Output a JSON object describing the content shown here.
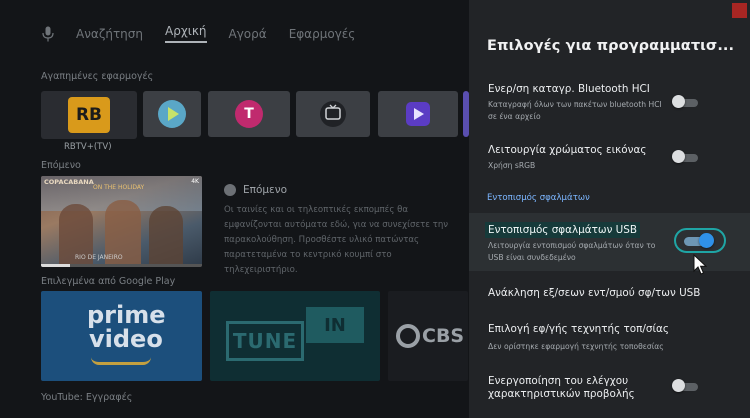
{
  "background": {
    "nav": {
      "items": [
        "Αναζήτηση",
        "Αρχική",
        "Αγορά",
        "Εφαρμογές"
      ],
      "selected": "Αρχική"
    },
    "favorites_label": "Αγαπημένες εφαρμογές",
    "favorites": [
      {
        "icon": "rbtv-icon",
        "label": "RBTV+(TV)",
        "logo_text": "RB"
      },
      {
        "icon": "play-icon"
      },
      {
        "icon": "t-icon",
        "logo_text": "T"
      },
      {
        "icon": "tv-icon"
      },
      {
        "icon": "video-icon"
      }
    ],
    "next_label": "Επόμενο",
    "next_card": {
      "caption_top": "COPACABANA",
      "caption_mid": "ON THE HOLIDAY",
      "hd_badge": "4K",
      "caption_bottom": "RIO DE JANEIRO"
    },
    "next_title": "Επόμενο",
    "next_description": "Οι ταινίες και οι τηλεοπτικές εκπομπές θα εμφανίζονται αυτόματα εδώ, για να συνεχίσετε την παρακολούθηση. Προσθέστε υλικό πατώντας παρατεταμένα το κεντρικό κουμπί στο τηλεχειριστήριο.",
    "google_play_label": "Επιλεγμένα από Google Play",
    "tiles": {
      "prime_line1": "prime",
      "prime_line2": "video",
      "tunein_left": "TUNE",
      "tunein_right": "IN",
      "cbs": "CBS N"
    },
    "youtube_label": "YouTube: Εγγραφές"
  },
  "panel": {
    "title": "Επιλογές για προγραμματισ...",
    "items": [
      {
        "title": "Ενερ/ση καταγρ. Bluetooth HCI",
        "subtitle_lines": [
          "Καταγραφή όλων των πακέτων bluetooth HCI",
          "σε ένα αρχείο"
        ],
        "toggle": false
      },
      {
        "title": "Λειτουργία χρώματος εικόνας",
        "subtitle_lines": [
          "Χρήση sRGB"
        ],
        "toggle": false
      },
      {
        "title": "Εντοπισμός σφαλμάτων USB",
        "subtitle_lines": [
          "Λειτουργία εντοπισμού σφαλμάτων όταν το",
          "USB είναι συνδεδεμένο"
        ],
        "toggle": true,
        "focused": true
      },
      {
        "title": "Ανάκληση εξ/σεων εντ/σμού σφ/των USB"
      },
      {
        "title": "Επιλογή εφ/γής τεχνητής τοπ/σίας",
        "subtitle_lines": [
          "Δεν ορίστηκε εφαρμογή τεχνητής τοποθεσίας"
        ]
      },
      {
        "title_lines": [
          "Ενεργοποίηση του ελέγχου",
          "χαρακτηριστικών προβολής"
        ],
        "toggle": false
      }
    ],
    "category_label": "Εντοπισμός σφαλμάτων"
  },
  "colors": {
    "panel_bg": "#222427",
    "focused_row_bg": "#2c3033",
    "accent_blue": "#2f91e8",
    "focus_ring": "#1fa5a5",
    "category_text": "#7cb6ff",
    "record_indicator": "#a82623"
  }
}
